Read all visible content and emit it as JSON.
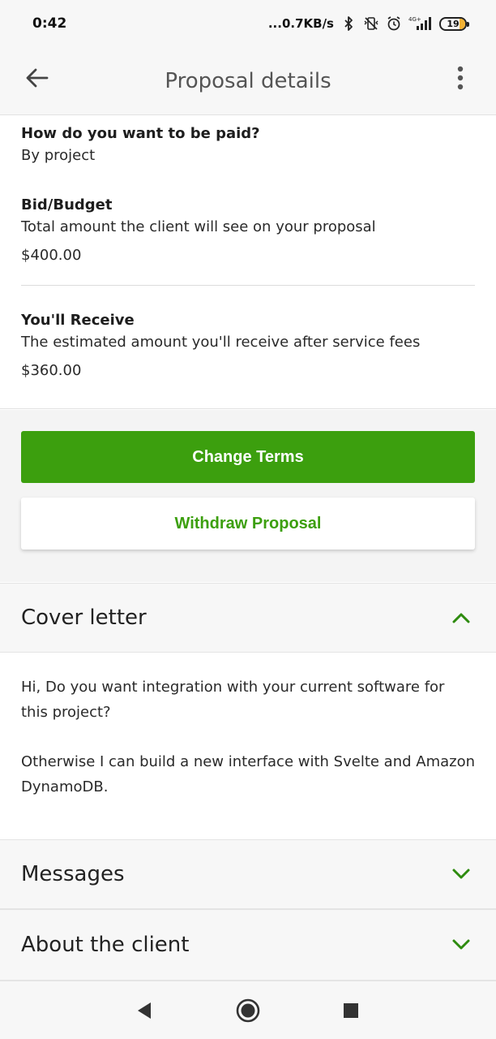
{
  "status_bar": {
    "time": "0:42",
    "speed": "...0.7KB/s",
    "network": "4G+",
    "battery": "19"
  },
  "app_bar": {
    "title": "Proposal details",
    "back_icon": "arrow-left-icon",
    "menu_icon": "more-vertical-icon"
  },
  "terms": {
    "payment_question": "How do you want to be paid?",
    "payment_value": "By project",
    "bid_label": "Bid/Budget",
    "bid_description": "Total amount the client will see on your proposal",
    "bid_amount": "$400.00",
    "receive_label": "You'll Receive",
    "receive_description": "The estimated amount you'll receive after service fees",
    "receive_amount": "$360.00"
  },
  "actions": {
    "change_terms": "Change Terms",
    "withdraw": "Withdraw Proposal"
  },
  "cover_letter": {
    "title": "Cover letter",
    "expanded": true,
    "paragraphs": [
      "Hi, Do you want integration with your current software for this project?",
      "Otherwise I can build a new interface with Svelte and Amazon DynamoDB."
    ]
  },
  "sections": {
    "messages": "Messages",
    "about_client": "About the client"
  },
  "colors": {
    "accent": "#3c9f0e",
    "chevron": "#2e8b0f"
  },
  "nav_bar": {
    "back_icon": "triangle-back-icon",
    "home_icon": "circle-home-icon",
    "recents_icon": "square-recents-icon"
  }
}
